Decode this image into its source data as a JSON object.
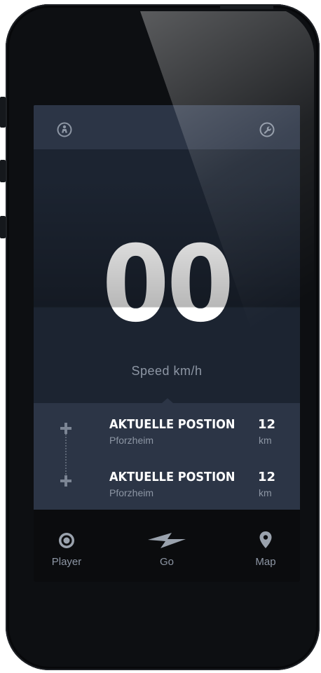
{
  "header": {
    "left_icon": "person-icon",
    "right_icon": "wrench-icon"
  },
  "speedometer": {
    "value": "00",
    "label": "Speed km/h"
  },
  "locations": [
    {
      "title": "AKTUELLE POSTION",
      "subtitle": "Pforzheim",
      "distance": "12",
      "unit": "km"
    },
    {
      "title": "AKTUELLE POSTION",
      "subtitle": "Pforzheim",
      "distance": "12",
      "unit": "km"
    }
  ],
  "tabs": [
    {
      "label": "Player",
      "icon": "record-icon"
    },
    {
      "label": "Go",
      "icon": "lightning-icon"
    },
    {
      "label": "Map",
      "icon": "map-pin-icon"
    }
  ],
  "colors": {
    "background": "#1c2431",
    "panel": "#2c3546",
    "tabbar": "#0b0c0e",
    "text_primary": "#ffffff",
    "text_secondary": "#8d96a4"
  }
}
